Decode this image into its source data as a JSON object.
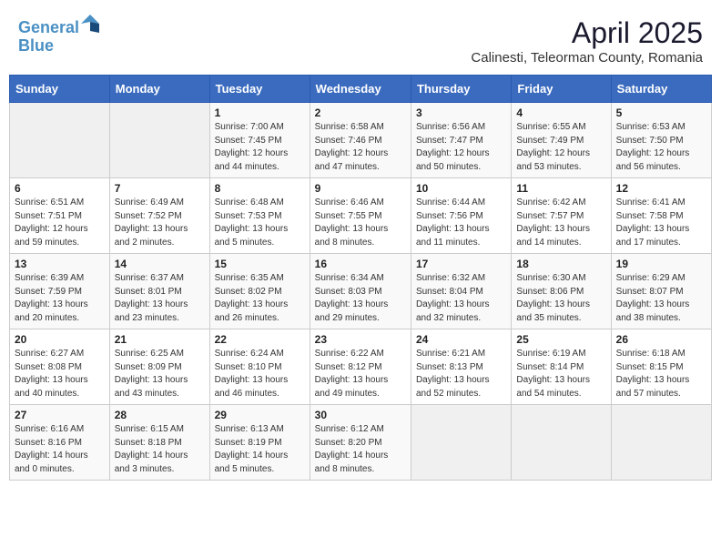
{
  "header": {
    "logo_line1": "General",
    "logo_line2": "Blue",
    "title": "April 2025",
    "subtitle": "Calinesti, Teleorman County, Romania"
  },
  "weekdays": [
    "Sunday",
    "Monday",
    "Tuesday",
    "Wednesday",
    "Thursday",
    "Friday",
    "Saturday"
  ],
  "weeks": [
    [
      {
        "day": "",
        "info": ""
      },
      {
        "day": "",
        "info": ""
      },
      {
        "day": "1",
        "info": "Sunrise: 7:00 AM\nSunset: 7:45 PM\nDaylight: 12 hours\nand 44 minutes."
      },
      {
        "day": "2",
        "info": "Sunrise: 6:58 AM\nSunset: 7:46 PM\nDaylight: 12 hours\nand 47 minutes."
      },
      {
        "day": "3",
        "info": "Sunrise: 6:56 AM\nSunset: 7:47 PM\nDaylight: 12 hours\nand 50 minutes."
      },
      {
        "day": "4",
        "info": "Sunrise: 6:55 AM\nSunset: 7:49 PM\nDaylight: 12 hours\nand 53 minutes."
      },
      {
        "day": "5",
        "info": "Sunrise: 6:53 AM\nSunset: 7:50 PM\nDaylight: 12 hours\nand 56 minutes."
      }
    ],
    [
      {
        "day": "6",
        "info": "Sunrise: 6:51 AM\nSunset: 7:51 PM\nDaylight: 12 hours\nand 59 minutes."
      },
      {
        "day": "7",
        "info": "Sunrise: 6:49 AM\nSunset: 7:52 PM\nDaylight: 13 hours\nand 2 minutes."
      },
      {
        "day": "8",
        "info": "Sunrise: 6:48 AM\nSunset: 7:53 PM\nDaylight: 13 hours\nand 5 minutes."
      },
      {
        "day": "9",
        "info": "Sunrise: 6:46 AM\nSunset: 7:55 PM\nDaylight: 13 hours\nand 8 minutes."
      },
      {
        "day": "10",
        "info": "Sunrise: 6:44 AM\nSunset: 7:56 PM\nDaylight: 13 hours\nand 11 minutes."
      },
      {
        "day": "11",
        "info": "Sunrise: 6:42 AM\nSunset: 7:57 PM\nDaylight: 13 hours\nand 14 minutes."
      },
      {
        "day": "12",
        "info": "Sunrise: 6:41 AM\nSunset: 7:58 PM\nDaylight: 13 hours\nand 17 minutes."
      }
    ],
    [
      {
        "day": "13",
        "info": "Sunrise: 6:39 AM\nSunset: 7:59 PM\nDaylight: 13 hours\nand 20 minutes."
      },
      {
        "day": "14",
        "info": "Sunrise: 6:37 AM\nSunset: 8:01 PM\nDaylight: 13 hours\nand 23 minutes."
      },
      {
        "day": "15",
        "info": "Sunrise: 6:35 AM\nSunset: 8:02 PM\nDaylight: 13 hours\nand 26 minutes."
      },
      {
        "day": "16",
        "info": "Sunrise: 6:34 AM\nSunset: 8:03 PM\nDaylight: 13 hours\nand 29 minutes."
      },
      {
        "day": "17",
        "info": "Sunrise: 6:32 AM\nSunset: 8:04 PM\nDaylight: 13 hours\nand 32 minutes."
      },
      {
        "day": "18",
        "info": "Sunrise: 6:30 AM\nSunset: 8:06 PM\nDaylight: 13 hours\nand 35 minutes."
      },
      {
        "day": "19",
        "info": "Sunrise: 6:29 AM\nSunset: 8:07 PM\nDaylight: 13 hours\nand 38 minutes."
      }
    ],
    [
      {
        "day": "20",
        "info": "Sunrise: 6:27 AM\nSunset: 8:08 PM\nDaylight: 13 hours\nand 40 minutes."
      },
      {
        "day": "21",
        "info": "Sunrise: 6:25 AM\nSunset: 8:09 PM\nDaylight: 13 hours\nand 43 minutes."
      },
      {
        "day": "22",
        "info": "Sunrise: 6:24 AM\nSunset: 8:10 PM\nDaylight: 13 hours\nand 46 minutes."
      },
      {
        "day": "23",
        "info": "Sunrise: 6:22 AM\nSunset: 8:12 PM\nDaylight: 13 hours\nand 49 minutes."
      },
      {
        "day": "24",
        "info": "Sunrise: 6:21 AM\nSunset: 8:13 PM\nDaylight: 13 hours\nand 52 minutes."
      },
      {
        "day": "25",
        "info": "Sunrise: 6:19 AM\nSunset: 8:14 PM\nDaylight: 13 hours\nand 54 minutes."
      },
      {
        "day": "26",
        "info": "Sunrise: 6:18 AM\nSunset: 8:15 PM\nDaylight: 13 hours\nand 57 minutes."
      }
    ],
    [
      {
        "day": "27",
        "info": "Sunrise: 6:16 AM\nSunset: 8:16 PM\nDaylight: 14 hours\nand 0 minutes."
      },
      {
        "day": "28",
        "info": "Sunrise: 6:15 AM\nSunset: 8:18 PM\nDaylight: 14 hours\nand 3 minutes."
      },
      {
        "day": "29",
        "info": "Sunrise: 6:13 AM\nSunset: 8:19 PM\nDaylight: 14 hours\nand 5 minutes."
      },
      {
        "day": "30",
        "info": "Sunrise: 6:12 AM\nSunset: 8:20 PM\nDaylight: 14 hours\nand 8 minutes."
      },
      {
        "day": "",
        "info": ""
      },
      {
        "day": "",
        "info": ""
      },
      {
        "day": "",
        "info": ""
      }
    ]
  ]
}
